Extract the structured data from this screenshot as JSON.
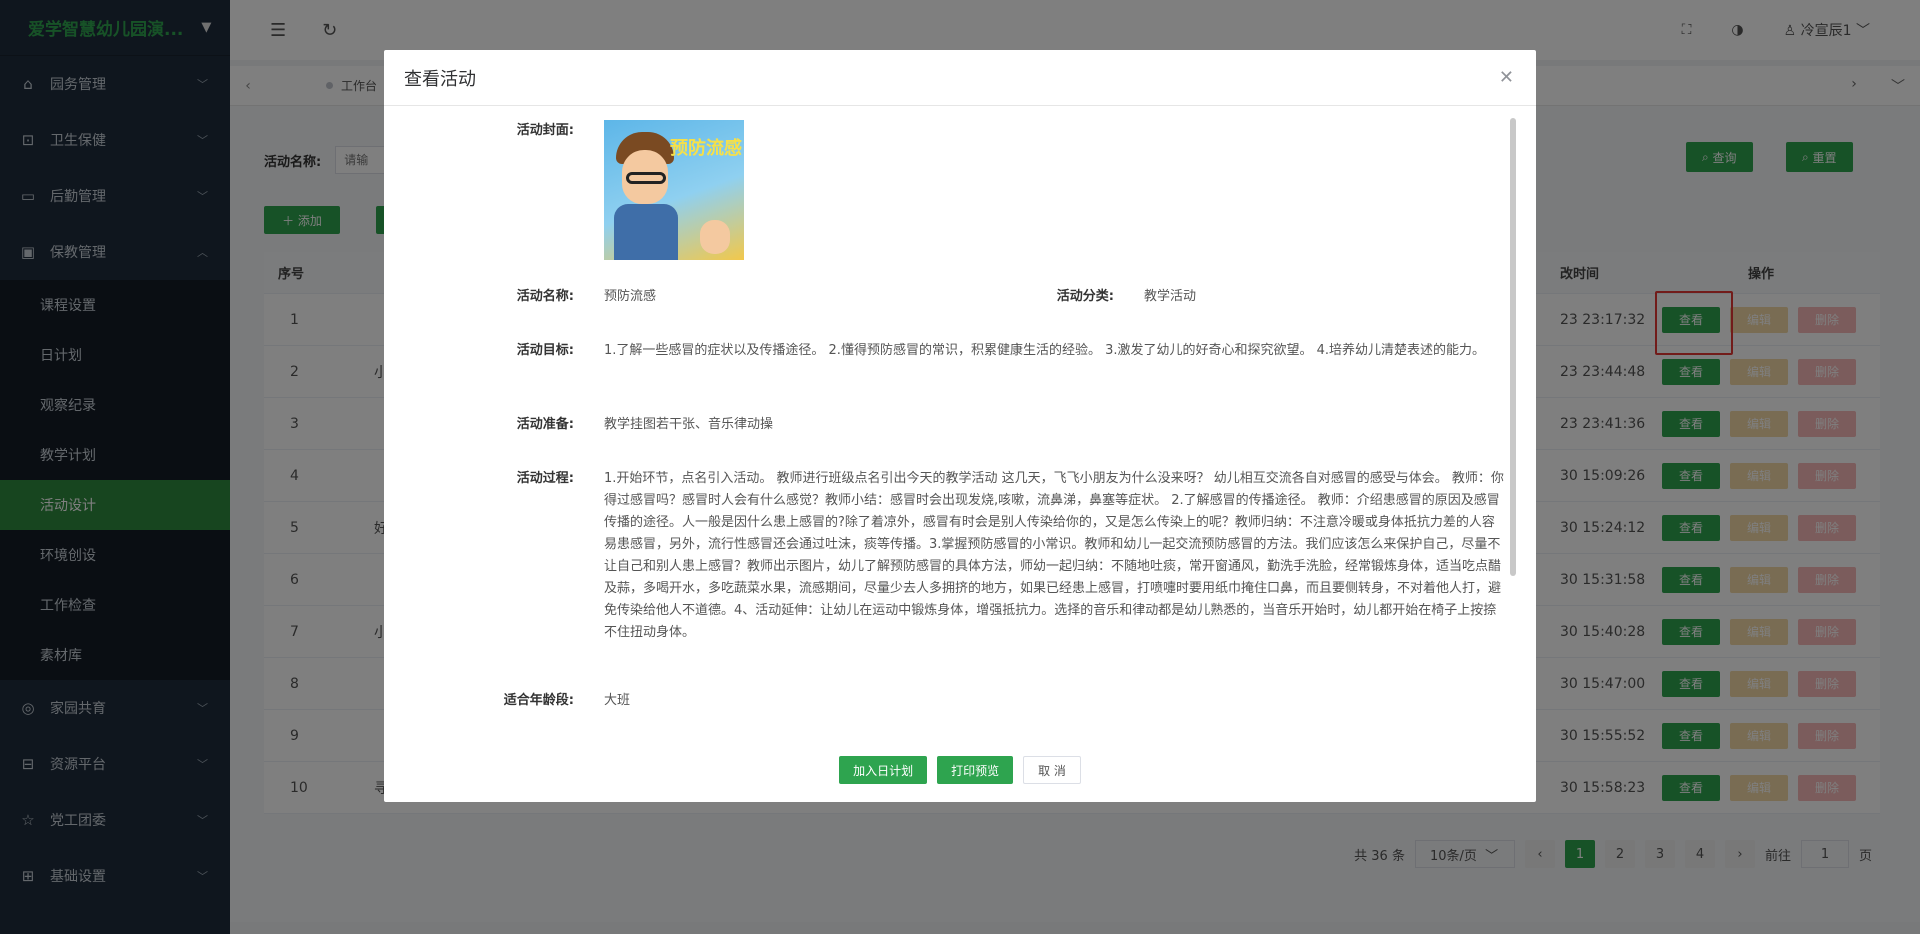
{
  "brand": {
    "name": "爱学智慧幼儿园演..."
  },
  "sidebar": {
    "items": [
      {
        "label": "园务管理"
      },
      {
        "label": "卫生保健"
      },
      {
        "label": "后勤管理"
      },
      {
        "label": "保教管理"
      }
    ],
    "sub_items": [
      {
        "label": "课程设置"
      },
      {
        "label": "日计划"
      },
      {
        "label": "观察纪录"
      },
      {
        "label": "教学计划"
      },
      {
        "label": "活动设计"
      },
      {
        "label": "环境创设"
      },
      {
        "label": "工作检查"
      },
      {
        "label": "素材库"
      }
    ],
    "items_after": [
      {
        "label": "家园共育"
      },
      {
        "label": "资源平台"
      },
      {
        "label": "党工团委"
      },
      {
        "label": "基础设置"
      }
    ]
  },
  "topbar": {
    "user": "冷宣辰1"
  },
  "tags": {
    "workbench": "工作台"
  },
  "search": {
    "label": "活动名称:",
    "placeholder": "请输",
    "query": "查询",
    "reset": "重置"
  },
  "toolbar": {
    "add": "添加"
  },
  "table": {
    "headers": {
      "no": "序号",
      "time": "改时间",
      "op": "操作"
    },
    "rows": [
      {
        "no": "1",
        "name": "",
        "time": "23 23:17:32"
      },
      {
        "no": "2",
        "name": "小",
        "time": "23 23:44:48"
      },
      {
        "no": "3",
        "name": "",
        "time": "23 23:41:36"
      },
      {
        "no": "4",
        "name": "",
        "time": "30 15:09:26"
      },
      {
        "no": "5",
        "name": "好",
        "time": "30 15:24:12"
      },
      {
        "no": "6",
        "name": "",
        "time": "30 15:31:58"
      },
      {
        "no": "7",
        "name": "小",
        "time": "30 15:40:28"
      },
      {
        "no": "8",
        "name": "",
        "time": "30 15:47:00"
      },
      {
        "no": "9",
        "name": "",
        "time": "30 15:55:52"
      },
      {
        "no": "10",
        "name": "寻",
        "time": "30 15:58:23"
      }
    ],
    "ops": {
      "view": "查看",
      "edit": "编辑",
      "del": "删除"
    }
  },
  "pager": {
    "total": "共 36 条",
    "size": "10条/页",
    "pages": [
      "1",
      "2",
      "3",
      "4"
    ],
    "goto_label": "前往",
    "goto_value": "1",
    "page_suffix": "页"
  },
  "modal": {
    "title": "查看活动",
    "cover_label": "活动封面:",
    "cover_text": "预防流感",
    "name_label": "活动名称:",
    "name": "预防流感",
    "category_label": "活动分类:",
    "category": "教学活动",
    "goal_label": "活动目标:",
    "goal": "1.了解一些感冒的症状以及传播途径。 2.懂得预防感冒的常识，积累健康生活的经验。 3.激发了幼儿的好奇心和探究欲望。 4.培养幼儿清楚表述的能力。",
    "prep_label": "活动准备:",
    "prep": "教学挂图若干张、音乐律动操",
    "process_label": "活动过程:",
    "process": "1.开始环节，点名引入活动。 教师进行班级点名引出今天的教学活动 这几天，飞飞小朋友为什么没来呀？ 幼儿相互交流各自对感冒的感受与体会。 教师：你得过感冒吗？感冒时人会有什么感觉？教师小结：感冒时会出现发烧,咳嗽，流鼻涕，鼻塞等症状。 2.了解感冒的传播途径。 教师：介绍患感冒的原因及感冒传播的途径。人一般是因什么患上感冒的?除了着凉外，感冒有时会是别人传染给你的，又是怎么传染上的呢？教师归纳：不注意冷暖或身体抵抗力差的人容易患感冒，另外，流行性感冒还会通过吐沫，痰等传播。3.掌握预防感冒的小常识。教师和幼儿一起交流预防感冒的方法。我们应该怎么来保护自己，尽量不让自己和别人患上感冒？教师出示图片，幼儿了解预防感冒的具体方法，师幼一起归纳：不随地吐痰，常开窗通风，勤洗手洗脸，经常锻炼身体，适当吃点醋及蒜，多喝开水，多吃蔬菜水果，流感期间，尽量少去人多拥挤的地方，如果已经患上感冒，打喷嚏时要用纸巾掩住口鼻，而且要侧转身，不对着他人打，避免传染给他人不道德。4、活动延伸：让幼儿在运动中锻炼身体，增强抵抗力。选择的音乐和律动都是幼儿熟悉的，当音乐开始时，幼儿都开始在椅子上按捺不住扭动身体。",
    "age_label": "适合年龄段:",
    "age": "大班",
    "buttons": {
      "add_plan": "加入日计划",
      "print": "打印预览",
      "cancel": "取 消"
    }
  },
  "colors": {
    "accent": "#2ea44f",
    "sidebar_bg": "#1f2d3d",
    "highlight": "#e53935"
  }
}
